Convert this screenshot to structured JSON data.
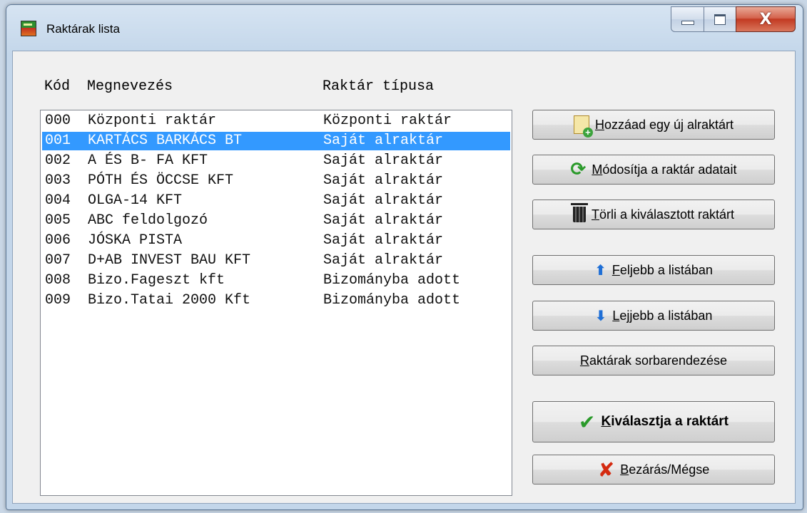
{
  "window": {
    "title": "Raktárak lista",
    "close_glyph": "X"
  },
  "columns": {
    "code": "Kód",
    "name": "Megnevezés",
    "type": "Raktár típusa"
  },
  "warehouses": [
    {
      "code": "000",
      "name": "Központi raktár",
      "type": "Központi raktár",
      "selected": false
    },
    {
      "code": "001",
      "name": "KARTÁCS BARKÁCS BT",
      "type": "Saját alraktár",
      "selected": true
    },
    {
      "code": "002",
      "name": "A ÉS B- FA KFT",
      "type": "Saját alraktár",
      "selected": false
    },
    {
      "code": "003",
      "name": "PÓTH ÉS ÖCCSE KFT",
      "type": "Saját alraktár",
      "selected": false
    },
    {
      "code": "004",
      "name": "OLGA-14 KFT",
      "type": "Saját alraktár",
      "selected": false
    },
    {
      "code": "005",
      "name": "ABC feldolgozó",
      "type": "Saját alraktár",
      "selected": false
    },
    {
      "code": "006",
      "name": "JÓSKA PISTA",
      "type": "Saját alraktár",
      "selected": false
    },
    {
      "code": "007",
      "name": "D+AB INVEST BAU KFT",
      "type": "Saját alraktár",
      "selected": false
    },
    {
      "code": "008",
      "name": "Bizo.Fageszt kft",
      "type": "Bizományba adott",
      "selected": false
    },
    {
      "code": "009",
      "name": "Bizo.Tatai 2000 Kft",
      "type": "Bizományba adott",
      "selected": false
    }
  ],
  "buttons": {
    "add": {
      "mnemonic": "H",
      "rest": "ozzáad egy új alraktárt",
      "icon": "add-document-icon"
    },
    "modify": {
      "mnemonic": "M",
      "rest": "ódosítja a raktár adatait",
      "icon": "refresh-icon"
    },
    "delete": {
      "mnemonic": "T",
      "rest": "örli a kiválasztott raktárt",
      "icon": "trash-icon"
    },
    "up": {
      "mnemonic": "F",
      "rest": "eljebb a listában",
      "icon": "arrow-up-icon"
    },
    "down": {
      "mnemonic": "L",
      "rest": "ejjebb a listában",
      "icon": "arrow-down-icon"
    },
    "sort": {
      "mnemonic": "R",
      "rest": "aktárak sorbarendezése"
    },
    "select": {
      "mnemonic": "K",
      "rest": "iválasztja a raktárt",
      "icon": "checkmark-icon"
    },
    "close": {
      "mnemonic": "B",
      "rest": "ezárás/Mégse",
      "icon": "red-x-icon"
    }
  },
  "colors": {
    "selection": "#3399ff",
    "check": "#2a9a2a",
    "cancel": "#d42a10",
    "arrow": "#1f6fd6"
  }
}
